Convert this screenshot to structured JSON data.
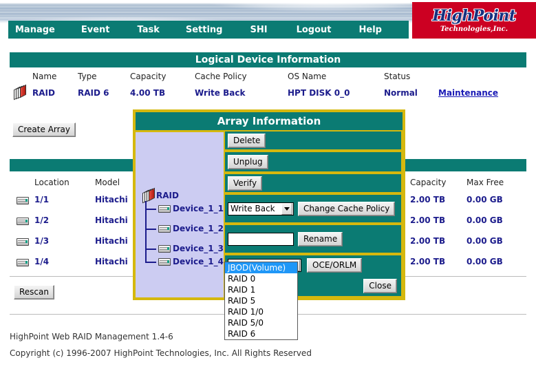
{
  "header": {
    "logo_main": "HighPoint",
    "logo_sub": "Technologies,Inc.",
    "nav": [
      {
        "label": "Manage"
      },
      {
        "label": "Event"
      },
      {
        "label": "Task"
      },
      {
        "label": "Setting"
      },
      {
        "label": "SHI"
      },
      {
        "label": "Logout"
      },
      {
        "label": "Help"
      }
    ]
  },
  "logical_device": {
    "title": "Logical Device Information",
    "columns": [
      "Name",
      "Type",
      "Capacity",
      "Cache Policy",
      "OS Name",
      "Status"
    ],
    "rows": [
      {
        "name": "RAID",
        "type": "RAID 6",
        "capacity": "4.00 TB",
        "cache_policy": "Write Back",
        "os_name": "HPT DISK 0_0",
        "status": "Normal",
        "action": "Maintenance"
      }
    ],
    "create_array_label": "Create Array"
  },
  "physical_device": {
    "columns": [
      "Location",
      "Model",
      "Capacity",
      "Max Free"
    ],
    "rows": [
      {
        "location": "1/1",
        "model": "Hitachi H",
        "capacity": "2.00 TB",
        "max_free": "0.00 GB"
      },
      {
        "location": "1/2",
        "model": "Hitachi H",
        "capacity": "2.00 TB",
        "max_free": "0.00 GB"
      },
      {
        "location": "1/3",
        "model": "Hitachi H",
        "capacity": "2.00 TB",
        "max_free": "0.00 GB"
      },
      {
        "location": "1/4",
        "model": "Hitachi H",
        "capacity": "2.00 TB",
        "max_free": "0.00 GB"
      }
    ],
    "rescan_label": "Rescan"
  },
  "dialog": {
    "title": "Array Information",
    "tree": {
      "root_label": "RAID",
      "children": [
        "Device_1_1",
        "Device_1_2",
        "Device_1_3",
        "Device_1_4"
      ]
    },
    "delete_label": "Delete",
    "unplug_label": "Unplug",
    "verify_label": "Verify",
    "cache_policy_value": "Write Back",
    "change_cache_policy_label": "Change Cache Policy",
    "rename_value": "",
    "rename_placeholder": "",
    "rename_label": "Rename",
    "raid_level_value": "JBOD(Volume)",
    "oce_orlm_label": "OCE/ORLM",
    "close_label": "Close",
    "raid_level_options": [
      "JBOD(Volume)",
      "RAID 0",
      "RAID 1",
      "RAID 5",
      "RAID 1/0",
      "RAID 5/0",
      "RAID 6"
    ],
    "raid_level_selected_index": 0
  },
  "footer": {
    "version": "HighPoint Web RAID Management 1.4-6",
    "copyright": "Copyright (c) 1996-2007 HighPoint Technologies, Inc. All Rights Reserved"
  },
  "colors": {
    "teal": "#0b7b73",
    "gold": "#d5b80e",
    "logo_red": "#cc0022",
    "link_blue": "#1a1ab5",
    "tree_bg": "#ccccf2",
    "highlight_blue": "#1f97f7"
  }
}
